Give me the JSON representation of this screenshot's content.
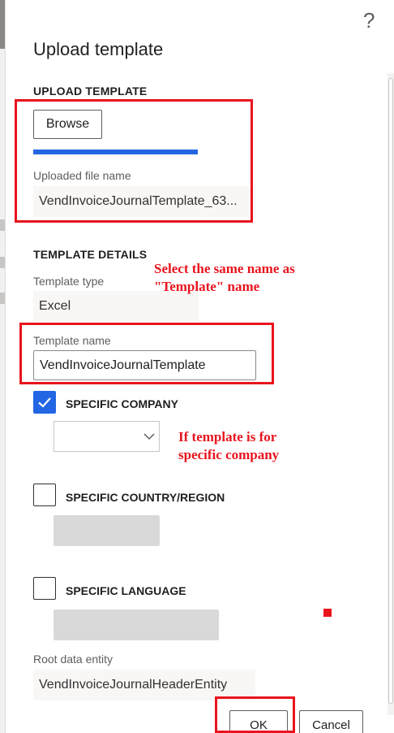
{
  "dialog": {
    "title": "Upload template",
    "help_glyph": "?"
  },
  "upload": {
    "section_title": "UPLOAD TEMPLATE",
    "browse_label": "Browse",
    "progress_percent": 100,
    "file_name_label": "Uploaded file name",
    "file_name_value": "VendInvoiceJournalTemplate_63..."
  },
  "details": {
    "section_title": "TEMPLATE DETAILS",
    "template_type_label": "Template type",
    "template_type_value": "Excel",
    "template_name_label": "Template name",
    "template_name_value": "VendInvoiceJournalTemplate",
    "specific_company": {
      "label": "SPECIFIC COMPANY",
      "checked": true,
      "selected": ""
    },
    "specific_country": {
      "label": "SPECIFIC COUNTRY/REGION",
      "checked": false
    },
    "specific_language": {
      "label": "SPECIFIC LANGUAGE",
      "checked": false
    },
    "root_entity_label": "Root data entity",
    "root_entity_value": "VendInvoiceJournalHeaderEntity"
  },
  "footer": {
    "ok_label": "OK",
    "cancel_label": "Cancel"
  },
  "annotations": {
    "note_template_name_line1": "Select the same name as",
    "note_template_name_line2": "\"Template\" name",
    "note_company_line1": "If template is for",
    "note_company_line2": "specific company"
  },
  "colors": {
    "accent": "#2266e3",
    "annotation_red": "#e8141e"
  }
}
